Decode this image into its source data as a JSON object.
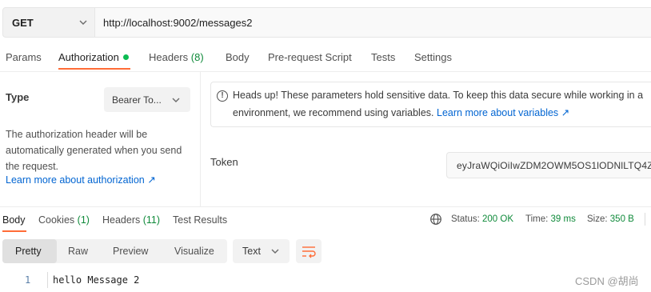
{
  "request": {
    "method": "GET",
    "url": "http://localhost:9002/messages2"
  },
  "request_tabs": {
    "params": "Params",
    "authorization": "Authorization",
    "headers": "Headers",
    "headers_count": "(8)",
    "body": "Body",
    "prerequest": "Pre-request Script",
    "tests": "Tests",
    "settings": "Settings"
  },
  "auth": {
    "type_label": "Type",
    "type_value": "Bearer To...",
    "description_lines": [
      "The authorization header will be",
      "automatically generated when you send",
      "the request."
    ],
    "learn_more": "Learn more about authorization ↗",
    "info_line1": "Heads up! These parameters hold sensitive data. To keep this data secure while working in a",
    "info_line2": "environment, we recommend using variables.",
    "info_link": "Learn more about variables ↗",
    "token_label": "Token",
    "token_value": "eyJraWQiOiIwZDM2OWM5OS1lODNlLTQ4Z"
  },
  "response_tabs": {
    "body": "Body",
    "cookies": "Cookies",
    "cookies_count": "(1)",
    "headers": "Headers",
    "headers_count": "(11)",
    "test_results": "Test Results"
  },
  "response_status": {
    "status_label": "Status:",
    "status_value": "200 OK",
    "time_label": "Time:",
    "time_value": "39 ms",
    "size_label": "Size:",
    "size_value": "350 B"
  },
  "format": {
    "pretty": "Pretty",
    "raw": "Raw",
    "preview": "Preview",
    "visualize": "Visualize",
    "text_type": "Text"
  },
  "response_body": {
    "line_number": "1",
    "line_text": "hello Message 2"
  },
  "watermark": "CSDN @胡尚",
  "colors": {
    "accent_orange": "#ff6c37",
    "success_green": "#0f8a3a",
    "link_blue": "#0265d2"
  }
}
